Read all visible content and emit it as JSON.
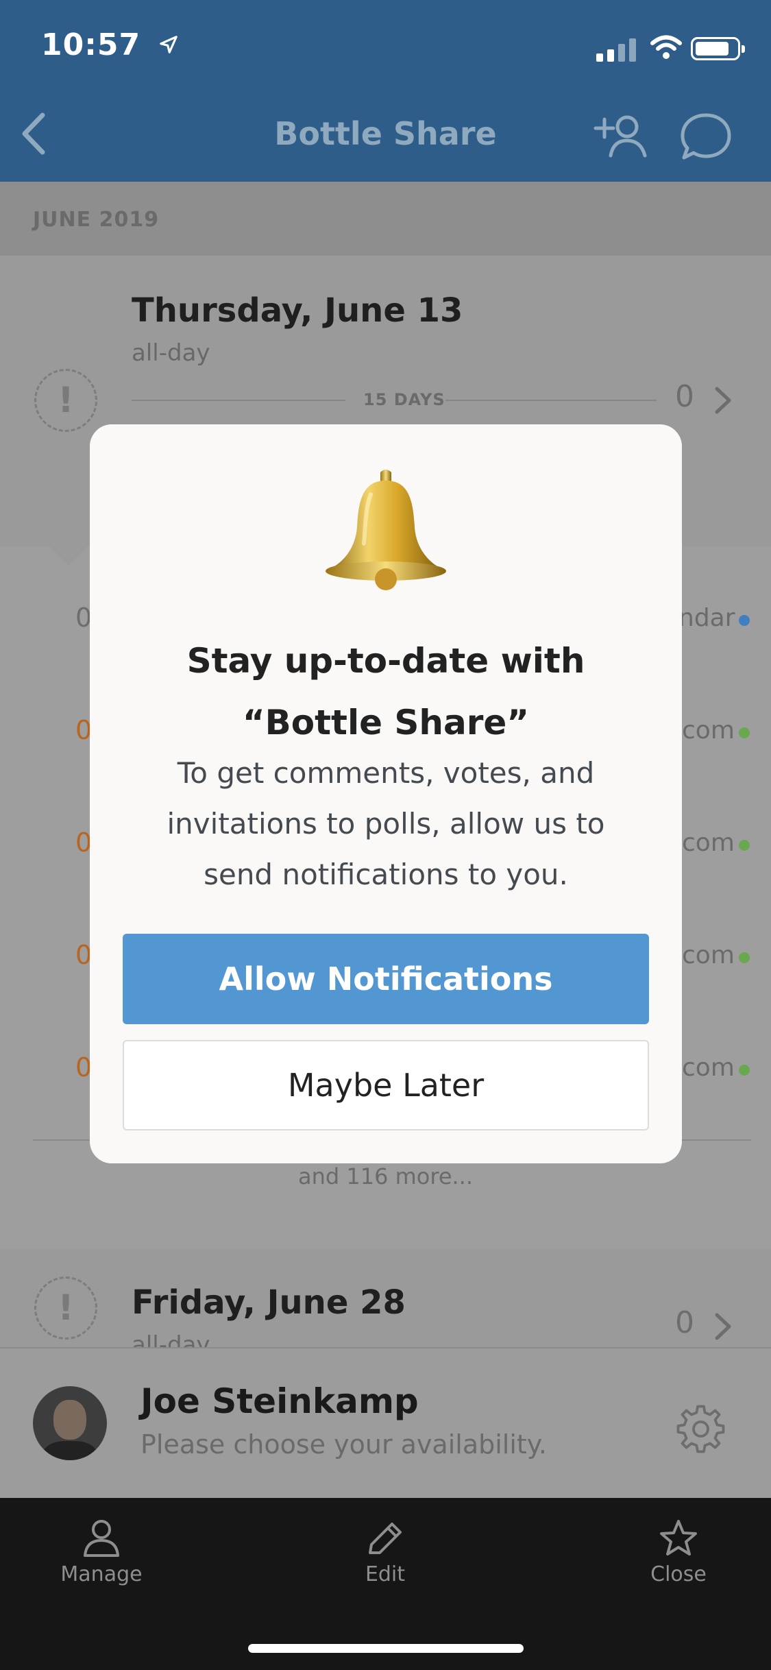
{
  "status_bar": {
    "time": "10:57"
  },
  "nav": {
    "title": "Bottle Share"
  },
  "section": {
    "header": "JUNE 2019"
  },
  "days": [
    {
      "title": "Thursday, June 13",
      "sub": "all-day",
      "countdown": "15 DAYS",
      "count": "0"
    },
    {
      "title": "Friday, June 28",
      "sub": "all-day",
      "count": "0"
    }
  ],
  "background_rows": [
    {
      "number": "0",
      "suffix": "ndar",
      "dot_color": "#3f7fc0"
    },
    {
      "number": "0",
      "suffix": "com",
      "dot_color": "#6aa84f"
    },
    {
      "number": "0",
      "suffix": "com",
      "dot_color": "#6aa84f"
    },
    {
      "number": "0",
      "suffix": "com",
      "dot_color": "#6aa84f"
    },
    {
      "number": "0",
      "suffix": "com",
      "dot_color": "#6aa84f"
    }
  ],
  "more_text": "and 116 more...",
  "user": {
    "name": "Joe Steinkamp",
    "status": "Please choose your availability."
  },
  "tabs": [
    {
      "label": "Manage",
      "icon": "person-icon"
    },
    {
      "label": "Edit",
      "icon": "pencil-icon"
    },
    {
      "label": "Close",
      "icon": "star-icon"
    }
  ],
  "modal": {
    "icon": "bell-icon",
    "title_line1": "Stay up-to-date with",
    "title_line2": "“Bottle Share”",
    "body_line1": "To get comments, votes, and",
    "body_line2": "invitations to polls, allow us to",
    "body_line3": "send notifications to you.",
    "allow_label": "Allow Notifications",
    "later_label": "Maybe Later"
  },
  "colors": {
    "nav_background": "#2d5d88",
    "primary_button": "#5397d2",
    "orange_number": "#b8651f",
    "tab_bar": "#161616"
  }
}
